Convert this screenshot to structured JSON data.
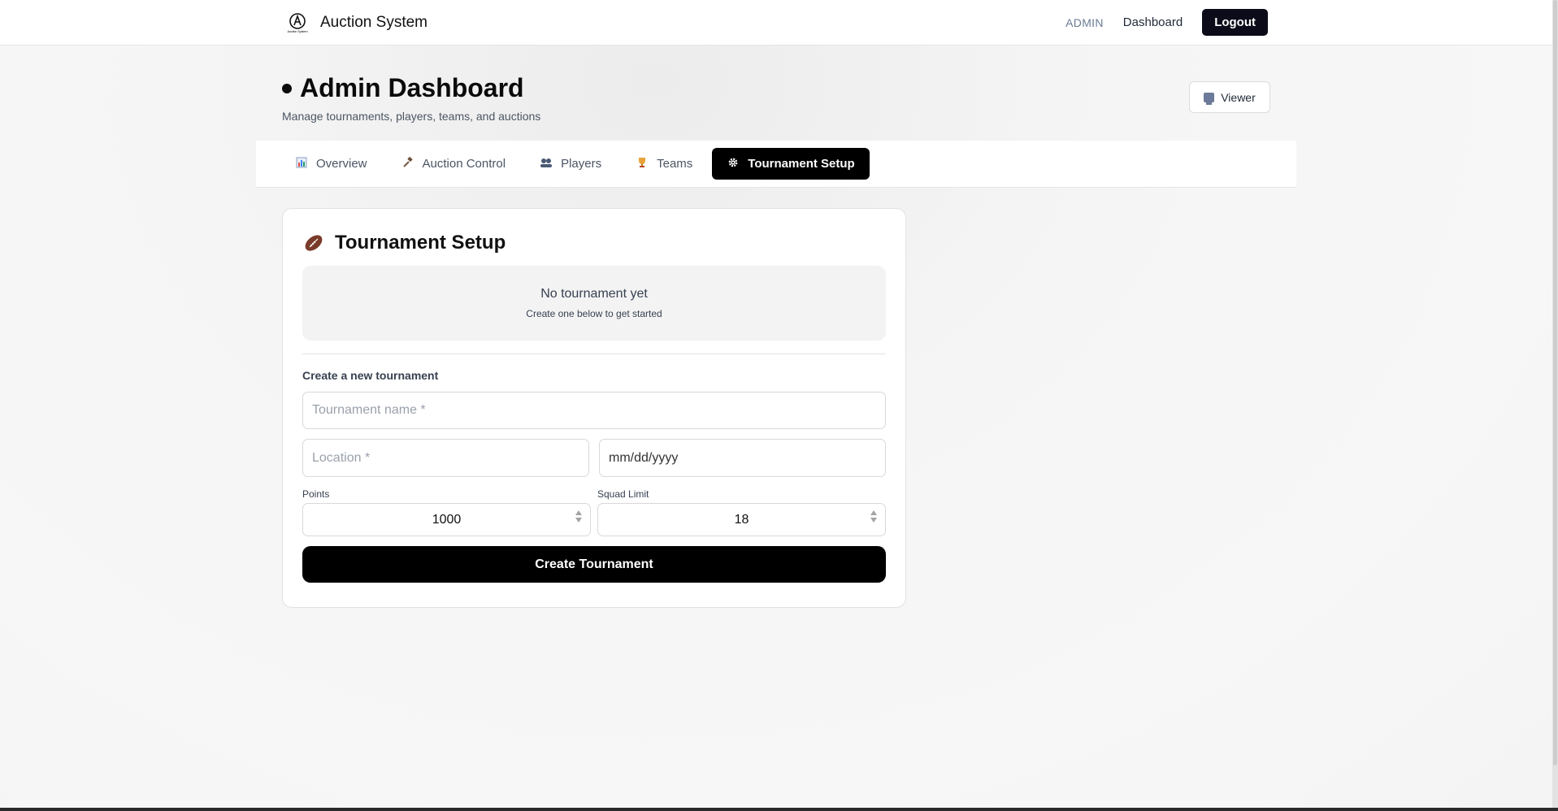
{
  "header": {
    "brand_title": "Auction System",
    "logo_text": "Auction System",
    "role": "ADMIN",
    "dashboard_link": "Dashboard",
    "logout_label": "Logout"
  },
  "page": {
    "title": "Admin Dashboard",
    "subtitle": "Manage tournaments, players, teams, and auctions",
    "viewer_label": "Viewer"
  },
  "tabs": [
    {
      "label": "Overview",
      "icon": "bar-chart-icon",
      "active": false
    },
    {
      "label": "Auction Control",
      "icon": "gavel-icon",
      "active": false
    },
    {
      "label": "Players",
      "icon": "users-icon",
      "active": false
    },
    {
      "label": "Teams",
      "icon": "trophy-icon",
      "active": false
    },
    {
      "label": "Tournament Setup",
      "icon": "gear-icon",
      "active": true
    }
  ],
  "setup": {
    "title": "Tournament Setup",
    "empty_title": "No tournament yet",
    "empty_sub": "Create one below to get started",
    "section_label": "Create a new tournament",
    "name_placeholder": "Tournament name *",
    "location_placeholder": "Location *",
    "date_value": "mm/dd/yyyy",
    "points_label": "Points",
    "points_value": "1000",
    "squad_label": "Squad Limit",
    "squad_value": "18",
    "create_label": "Create Tournament"
  },
  "colors": {
    "accent": "#000000",
    "logout_bg": "#0b0b19",
    "role_text": "#6b7c93"
  }
}
